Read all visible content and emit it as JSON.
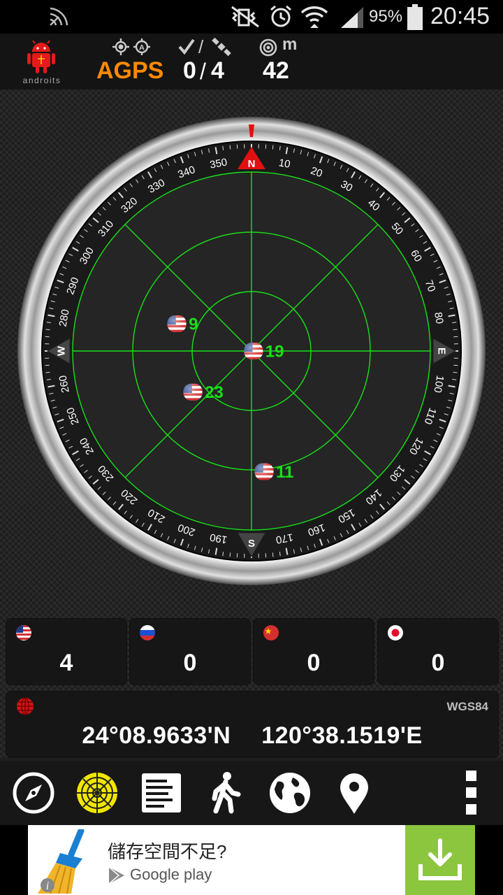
{
  "status_bar": {
    "battery": "95%",
    "time": "20:45"
  },
  "header": {
    "app_name": "anDROITS",
    "mode_value": "AGPS",
    "satellites_used": "0",
    "satellites_total": "4",
    "accuracy_unit": "m",
    "accuracy_value": "42"
  },
  "compass": {
    "north": "N",
    "south": "S",
    "east": "E",
    "west": "W",
    "dial_numbers": [
      "10",
      "20",
      "30",
      "40",
      "50",
      "60",
      "70",
      "80",
      "100",
      "110",
      "120",
      "130",
      "140",
      "150",
      "160",
      "170",
      "190",
      "200",
      "210",
      "220",
      "230",
      "240",
      "250",
      "260",
      "280",
      "290",
      "300",
      "310",
      "320",
      "330",
      "340",
      "350"
    ]
  },
  "satellites": [
    {
      "id": "9",
      "constellation": "GPS",
      "azimuth": 290,
      "elevation": 50
    },
    {
      "id": "19",
      "constellation": "GPS",
      "azimuth": 90,
      "elevation": 89
    },
    {
      "id": "23",
      "constellation": "GPS",
      "azimuth": 235,
      "elevation": 54
    },
    {
      "id": "11",
      "constellation": "GPS",
      "azimuth": 174,
      "elevation": 29
    }
  ],
  "gnss_counts": [
    {
      "system": "GPS (USA)",
      "flag": "us-flag-icon",
      "count": "4"
    },
    {
      "system": "GLONASS (Russia)",
      "flag": "russia-flag-icon",
      "count": "0"
    },
    {
      "system": "BeiDou (China)",
      "flag": "china-flag-icon",
      "count": "0"
    },
    {
      "system": "QZSS (Japan)",
      "flag": "japan-flag-icon",
      "count": "0"
    }
  ],
  "position": {
    "datum": "WGS84",
    "latitude": "24°08.9633'N",
    "longitude": "120°38.1519'E"
  },
  "toolbar": [
    "compass-icon",
    "radar-icon",
    "notes-icon",
    "walking-icon",
    "globe-icon",
    "map-pin-icon",
    "overflow-menu-icon"
  ],
  "ad": {
    "text": "儲存空間不足?",
    "store": "Google play"
  },
  "colors": {
    "accent_orange": "#ff8a00",
    "radar_green": "#00ff00",
    "ad_button_green": "#8cc63f"
  }
}
